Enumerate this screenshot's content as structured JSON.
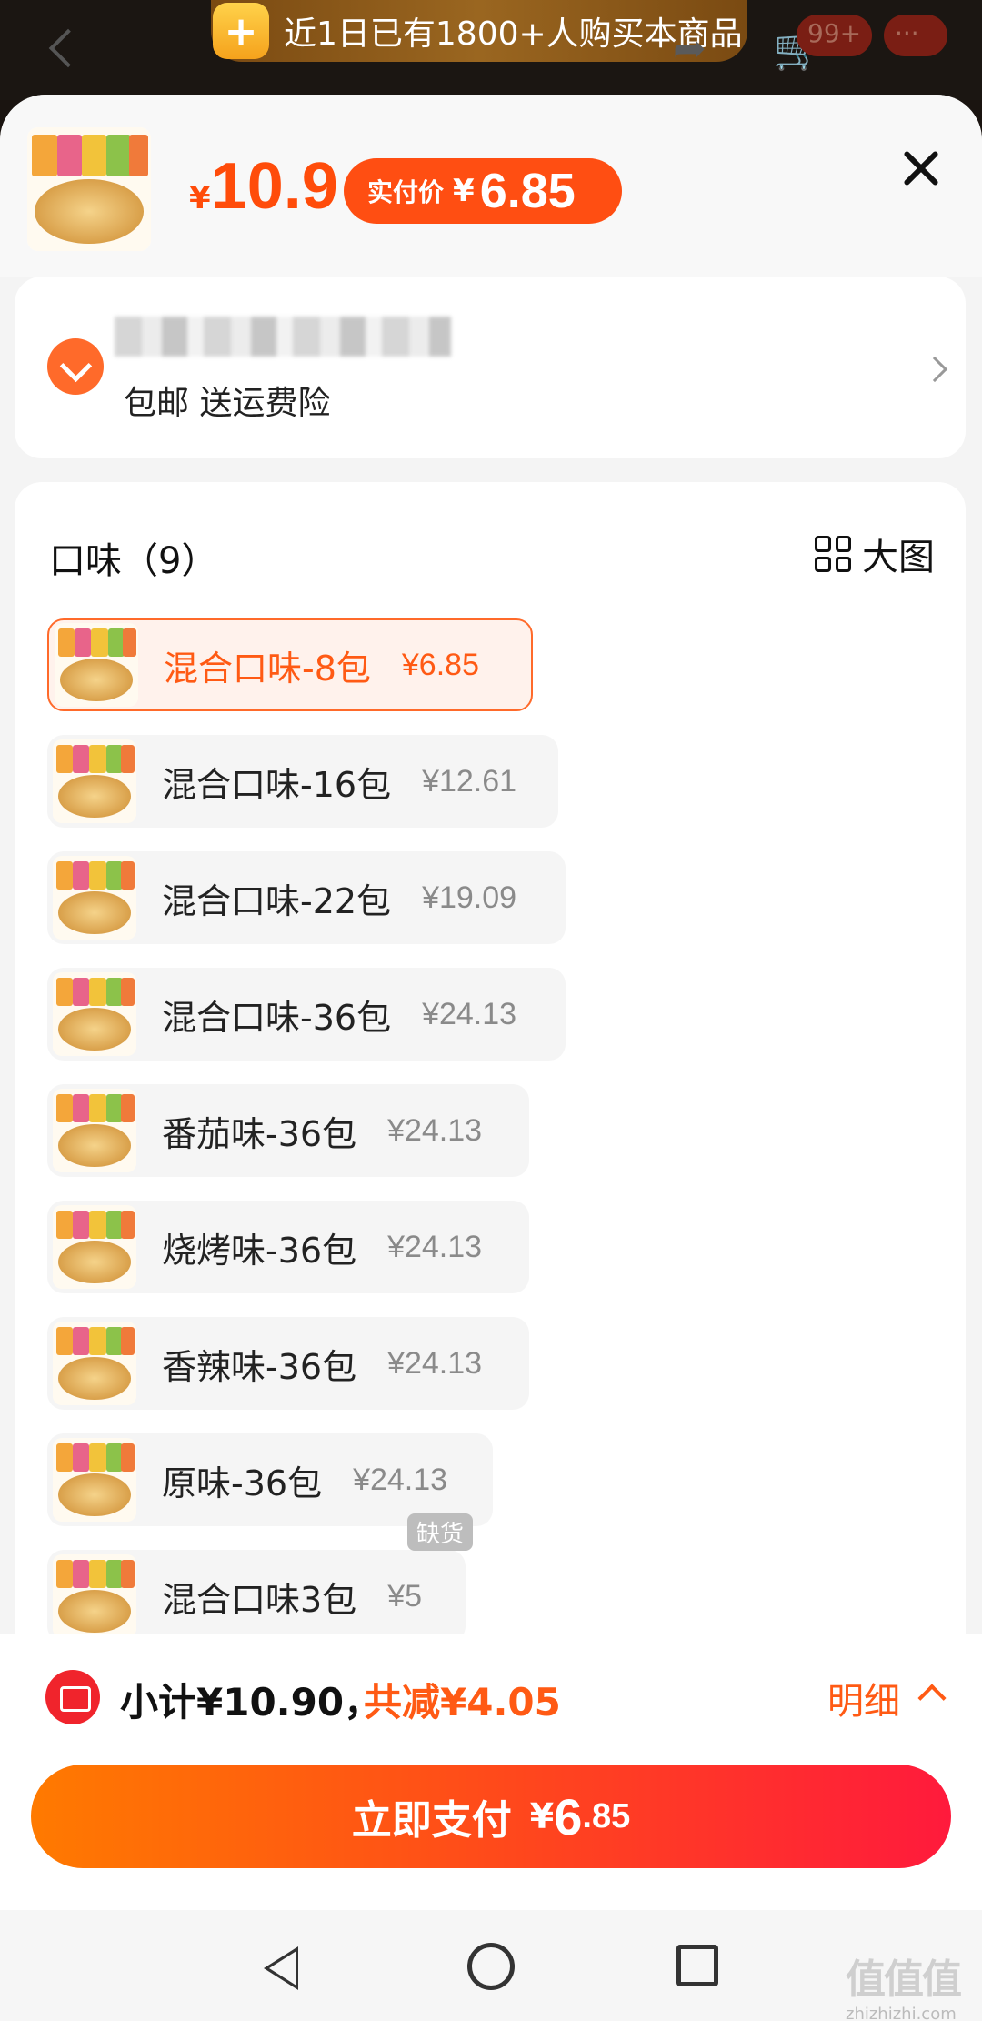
{
  "banner": {
    "text": "近1日已有1800+人购买本商品"
  },
  "top": {
    "badge": "99+"
  },
  "product": {
    "price_yen": "¥",
    "price": "10.9",
    "paid_label": "实付价",
    "paid_yen": "¥",
    "paid_value": "6.85"
  },
  "address": {
    "subtitle": "包邮 送运费险"
  },
  "spec": {
    "title": "口味（9）",
    "bigpic_label": "大图",
    "options": [
      {
        "name": "混合口味-8包",
        "price": "¥6.85",
        "selected": true
      },
      {
        "name": "混合口味-16包",
        "price": "¥12.61"
      },
      {
        "name": "混合口味-22包",
        "price": "¥19.09"
      },
      {
        "name": "混合口味-36包",
        "price": "¥24.13"
      },
      {
        "name": "番茄味-36包",
        "price": "¥24.13"
      },
      {
        "name": "烧烤味-36包",
        "price": "¥24.13"
      },
      {
        "name": "香辣味-36包",
        "price": "¥24.13"
      },
      {
        "name": "原味-36包",
        "price": "¥24.13"
      },
      {
        "name": "混合口味3包",
        "price": "¥5",
        "badge": "缺货"
      }
    ]
  },
  "footer": {
    "subtotal": "小计¥10.90，",
    "discount": "共减¥4.05",
    "detail": "明细",
    "pay_label": "立即支付",
    "pay_yen": "¥",
    "pay_int": "6",
    "pay_dec": ".85"
  },
  "watermark": {
    "main": "值值值",
    "sub": "zhizhizhi.com"
  },
  "colors": {
    "accent": "#ff5a14",
    "pay_start": "#ff7a00",
    "pay_end": "#ff1a3c",
    "banner": "#9a6620"
  }
}
